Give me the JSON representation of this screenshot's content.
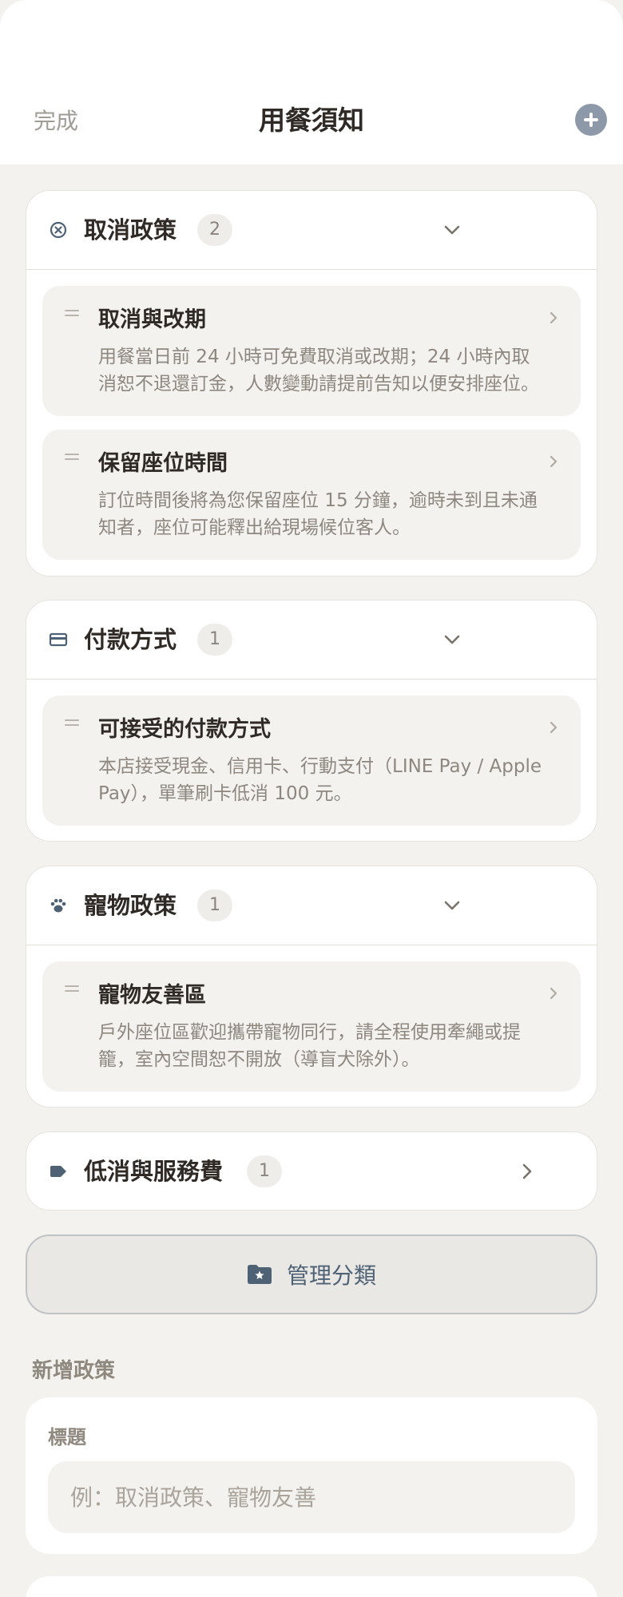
{
  "header": {
    "done_label": "完成",
    "title": "用餐須知",
    "add_icon": "plus-circle-icon"
  },
  "categories": [
    {
      "title": "取消政策",
      "count": "2",
      "icon": "x-circle-icon",
      "expanded": true,
      "items": [
        {
          "title": "取消與改期",
          "desc": "用餐當日前 24 小時可免費取消或改期；24 小時內取消恕不退還訂金，人數變動請提前告知以便安排座位。"
        },
        {
          "title": "保留座位時間",
          "desc": "訂位時間後將為您保留座位 15 分鐘，逾時未到且未通知者，座位可能釋出給現場候位客人。"
        }
      ]
    },
    {
      "title": "付款方式",
      "count": "1",
      "icon": "credit-card-icon",
      "expanded": true,
      "items": [
        {
          "title": "可接受的付款方式",
          "desc": "本店接受現金、信用卡、行動支付（LINE Pay / Apple Pay），單筆刷卡低消 100 元。"
        }
      ]
    },
    {
      "title": "寵物政策",
      "count": "1",
      "icon": "paw-icon",
      "expanded": true,
      "items": [
        {
          "title": "寵物友善區",
          "desc": "戶外座位區歡迎攜帶寵物同行，請全程使用牽繩或提籠，室內空間恕不開放（導盲犬除外）。"
        }
      ]
    },
    {
      "title": "低消與服務費",
      "count": "1",
      "icon": "tag-icon",
      "expanded": false,
      "items": []
    }
  ],
  "manage": {
    "label": "管理分類",
    "icon": "folder-star-icon"
  },
  "new_policy": {
    "section_label": "新增政策",
    "field_label": "標題",
    "placeholder": "例：取消政策、寵物友善",
    "value": ""
  },
  "colors": {
    "accent": "#4f6275",
    "background": "#f3f2ee",
    "card": "#ffffff",
    "muted": "#8e8780"
  }
}
